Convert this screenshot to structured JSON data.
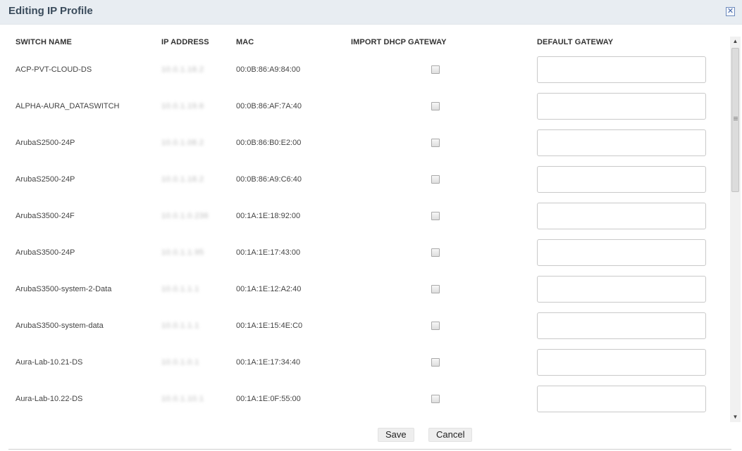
{
  "dialog": {
    "title": "Editing IP Profile",
    "close_icon": "close-icon"
  },
  "columns": {
    "switch_name": "SWITCH NAME",
    "ip_address": "IP ADDRESS",
    "mac": "MAC",
    "import_dhcp_gateway": "IMPORT DHCP GATEWAY",
    "default_gateway": "DEFAULT GATEWAY"
  },
  "rows": [
    {
      "name": "ACP-PVT-CLOUD-DS",
      "ip": "10.0.1.18.2",
      "mac": "00:0B:86:A9:84:00",
      "import_dhcp": false,
      "gateway": ""
    },
    {
      "name": "ALPHA-AURA_DATASWITCH",
      "ip": "10.0.1.19.6",
      "mac": "00:0B:86:AF:7A:40",
      "import_dhcp": false,
      "gateway": ""
    },
    {
      "name": "ArubaS2500-24P",
      "ip": "10.0.1.08.2",
      "mac": "00:0B:86:B0:E2:00",
      "import_dhcp": false,
      "gateway": ""
    },
    {
      "name": "ArubaS2500-24P",
      "ip": "10.0.1.18.2",
      "mac": "00:0B:86:A9:C6:40",
      "import_dhcp": false,
      "gateway": ""
    },
    {
      "name": "ArubaS3500-24F",
      "ip": "10.0.1.0.236",
      "mac": "00:1A:1E:18:92:00",
      "import_dhcp": false,
      "gateway": ""
    },
    {
      "name": "ArubaS3500-24P",
      "ip": "10.0.1.1.95",
      "mac": "00:1A:1E:17:43:00",
      "import_dhcp": false,
      "gateway": ""
    },
    {
      "name": "ArubaS3500-system-2-Data",
      "ip": "10.0.1.1.1",
      "mac": "00:1A:1E:12:A2:40",
      "import_dhcp": false,
      "gateway": ""
    },
    {
      "name": "ArubaS3500-system-data",
      "ip": "10.0.1.1.1",
      "mac": "00:1A:1E:15:4E:C0",
      "import_dhcp": false,
      "gateway": ""
    },
    {
      "name": "Aura-Lab-10.21-DS",
      "ip": "10.0.1.0.1",
      "mac": "00:1A:1E:17:34:40",
      "import_dhcp": false,
      "gateway": ""
    },
    {
      "name": "Aura-Lab-10.22-DS",
      "ip": "10.0.1.10.1",
      "mac": "00:1A:1E:0F:55:00",
      "import_dhcp": false,
      "gateway": ""
    }
  ],
  "footer": {
    "save_label": "Save",
    "cancel_label": "Cancel"
  },
  "scrollbar": {
    "up_icon": "chevron-up-icon",
    "down_icon": "chevron-down-icon",
    "position": 0.0
  }
}
